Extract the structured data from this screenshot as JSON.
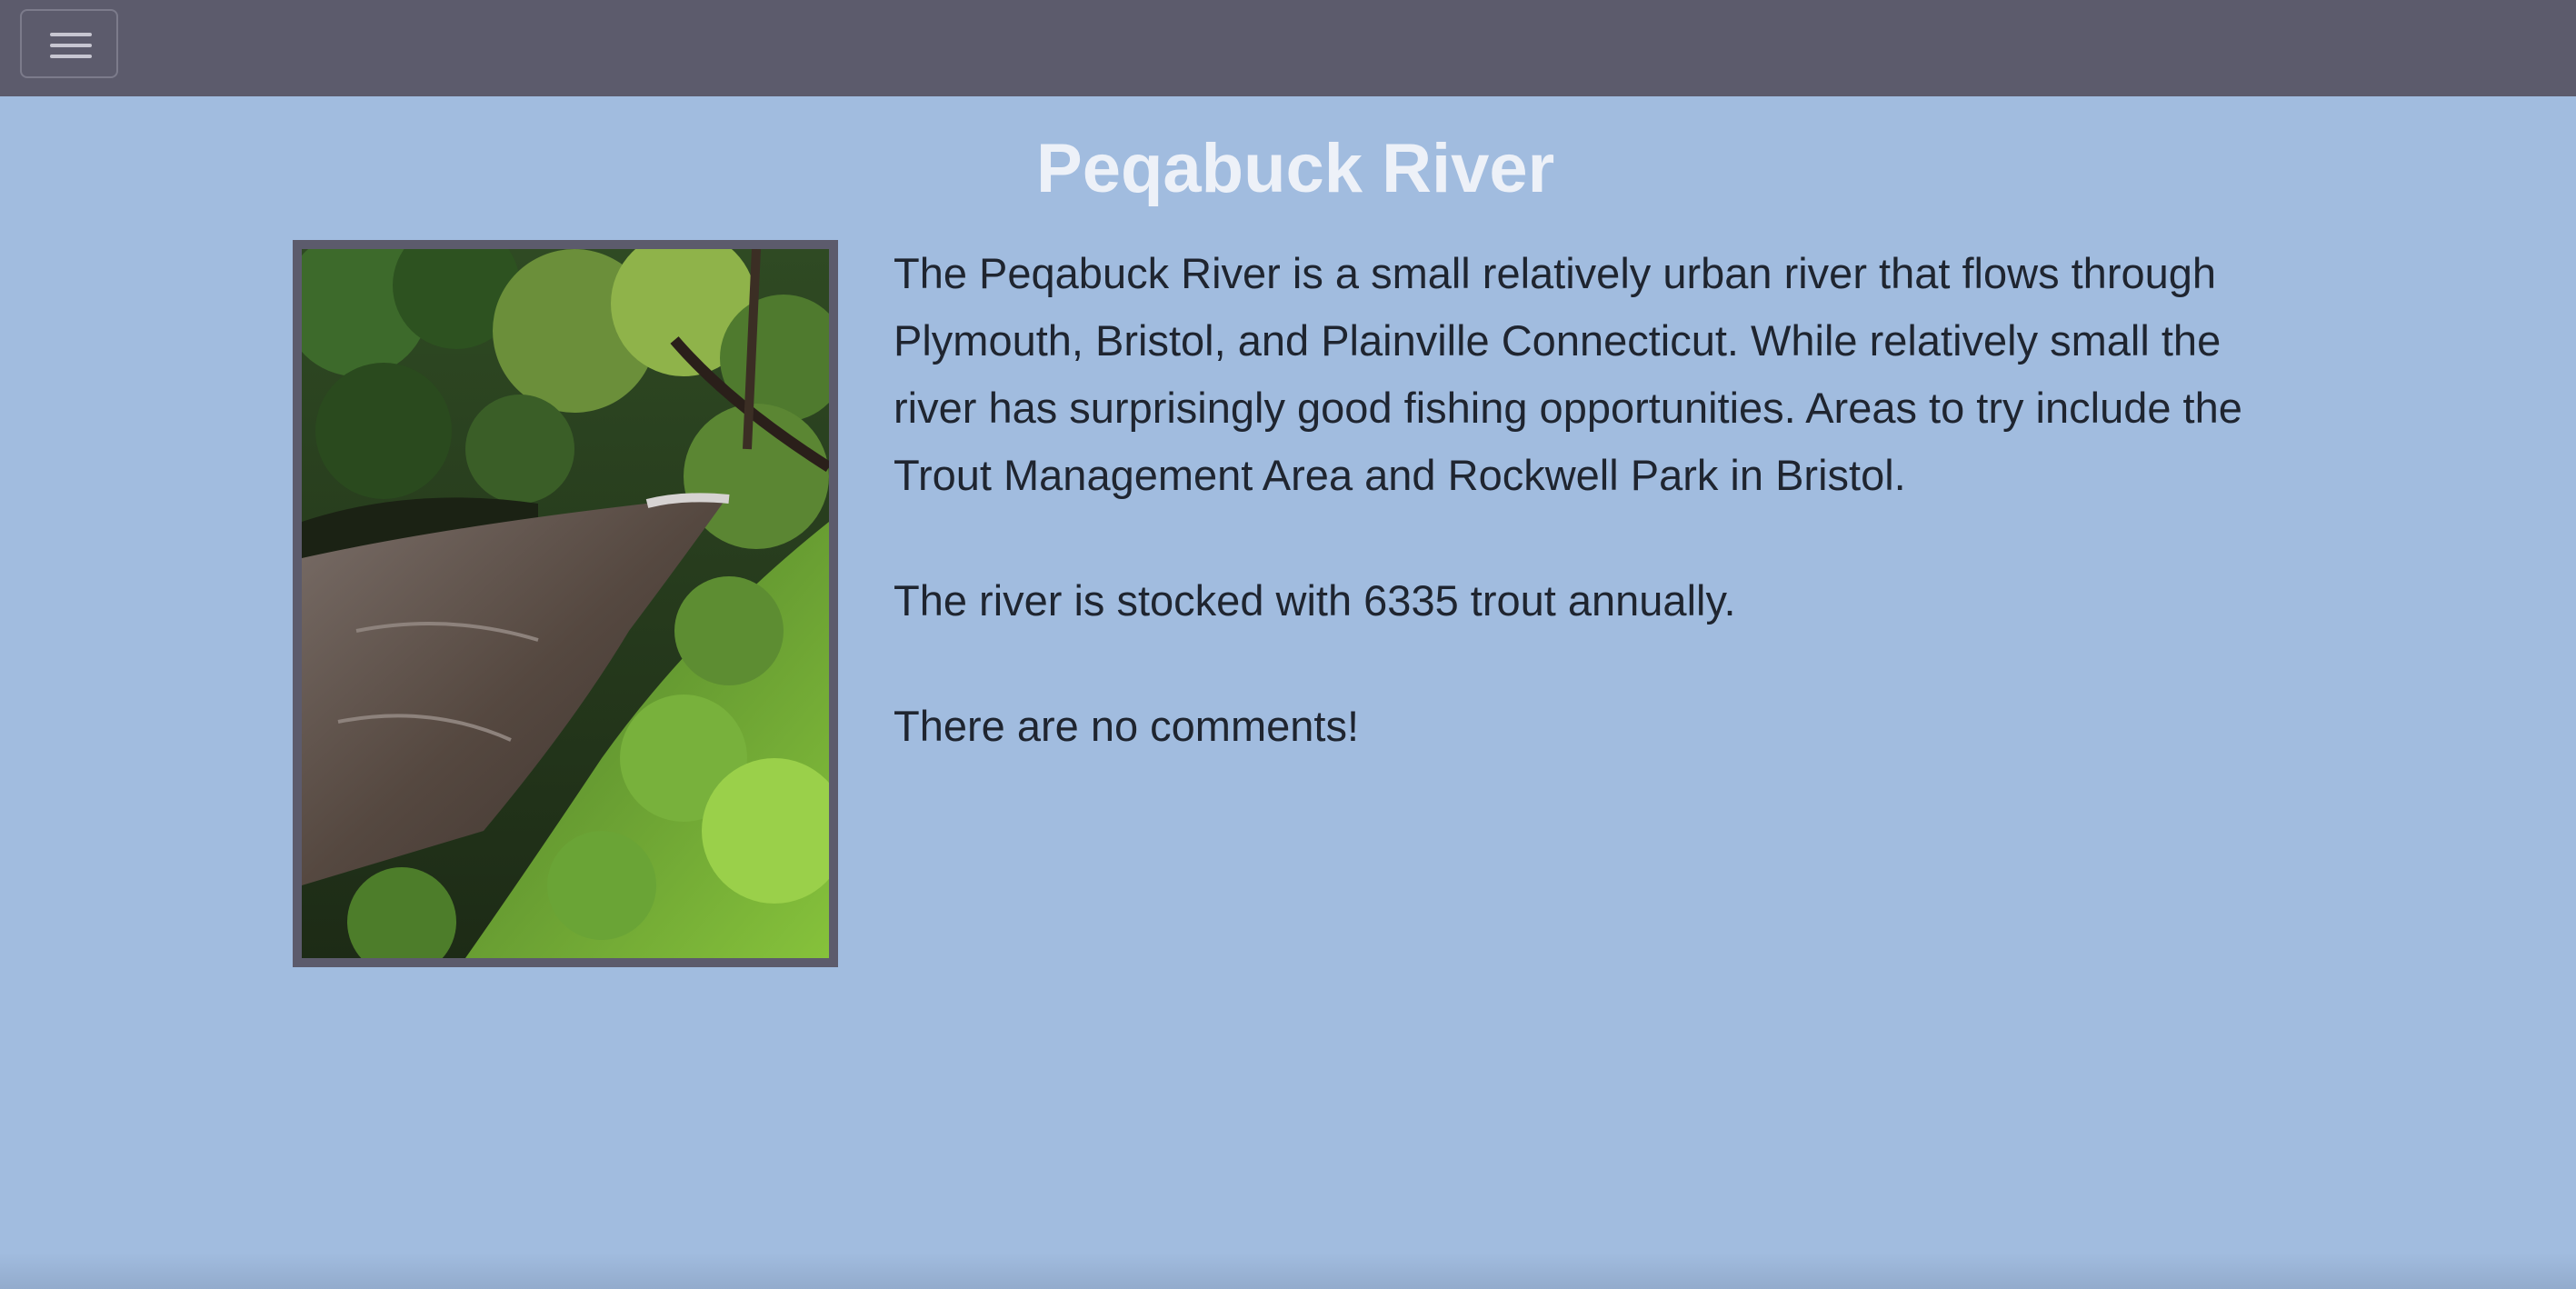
{
  "navbar": {
    "menu_icon": "hamburger-menu-icon",
    "background": "#5c5b6c"
  },
  "page": {
    "title": "Peqabuck River",
    "background": "#a1bcdf"
  },
  "river": {
    "photo_icon": "river-photo",
    "description": "The Peqabuck River is a small relatively urban river that flows through Plymouth, Bristol, and Plainville Connecticut. While relatively small the river has surprisingly good fishing opportunities. Areas to try include the Trout Management Area and Rockwell Park in Bristol.",
    "stocking": "The river is stocked with 6335 trout annually.",
    "comments": "There are no comments!"
  }
}
